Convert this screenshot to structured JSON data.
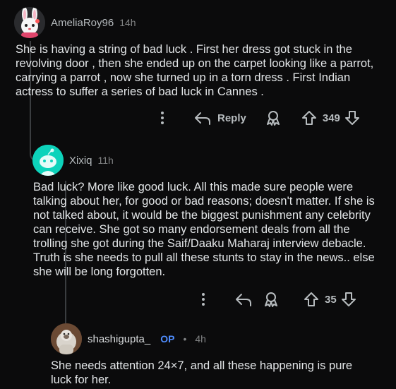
{
  "comments": [
    {
      "username": "AmeliaRoy96",
      "time": "14h",
      "body": "She is having a string of bad luck . First her dress got stuck in the revolving door , then she ended up on the carpet looking like a parrot, carrying a parrot , now she turned up in a torn dress . First Indian actress to suffer a series of bad luck in Cannes .",
      "reply_label": "Reply",
      "votes": "349",
      "avatar_icon": "bunny-avatar-icon"
    },
    {
      "username": "Xixiq",
      "time": "11h",
      "body": "Bad luck? More like good luck. All this made sure people were talking about her, for good or bad reasons; doesn't matter. If she is not talked about, it would be the biggest punishment any celebrity can receive. She got so many endorsement deals from all the trolling she got during the Saif/Daaku Maharaj interview debacle. Truth is she needs to pull all these stunts to stay in the news.. else she will be long forgotten.",
      "votes": "35",
      "avatar_icon": "default-snoo-avatar-icon"
    },
    {
      "username": "shashigupta_",
      "op_badge": "OP",
      "separator": "•",
      "time": "4h",
      "body": "She needs attention 24×7, and all these happening is pure luck for her.",
      "avatar_icon": "monkey-avatar-icon"
    }
  ],
  "colors": {
    "background": "#0b0b0c",
    "op_badge": "#4f8dff",
    "thread_line": "#3a3d40",
    "snoo_avatar_bg": "#0dd3bb"
  }
}
